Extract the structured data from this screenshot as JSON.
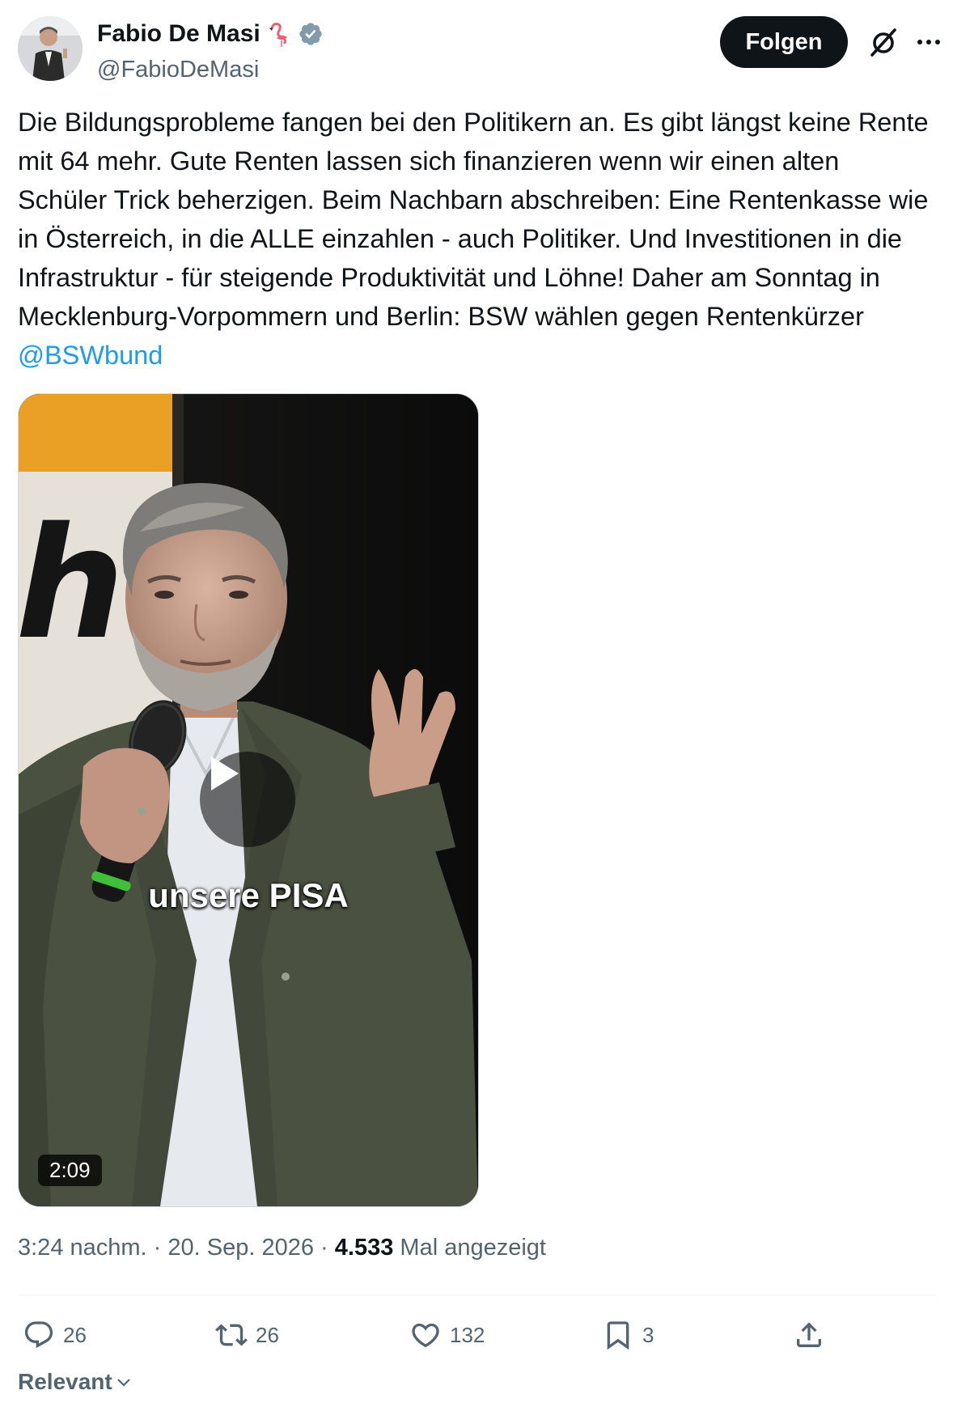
{
  "author": {
    "name": "Fabio De Masi",
    "emoji": "🦩",
    "handle": "@FabioDeMasi",
    "verified": true
  },
  "header": {
    "follow_label": "Folgen"
  },
  "tweet": {
    "text": "Die Bildungsprobleme fangen bei den Politikern an. Es gibt längst keine Rente mit 64 mehr. Gute Renten lassen sich finanzieren wenn wir einen alten Schüler Trick beherzigen. Beim Nachbarn abschreiben: Eine Rentenkasse wie in Österreich, in die ALLE einzahlen - auch Politiker. Und Investitionen in die Infrastruktur - für  steigende Produktivität und Löhne! Daher am Sonntag in Mecklenburg-Vorpommern und Berlin: BSW wählen gegen Rentenkürzer ",
    "mention": "@BSWbund"
  },
  "video": {
    "caption": "unsere PISA",
    "duration": "2:09",
    "banner_letter": "h"
  },
  "meta": {
    "time": "3:24 nachm.",
    "separator": " · ",
    "date": "20. Sep. 2026",
    "views_count": "4.533",
    "views_label": "Mal angezeigt"
  },
  "actions": {
    "replies": "26",
    "reposts": "26",
    "likes": "132",
    "bookmarks": "3"
  },
  "sort": {
    "label": "Relevant"
  },
  "colors": {
    "text": "#0f1419",
    "secondary": "#536471",
    "link": "#1d9bf0",
    "follow_bg": "#0f1419",
    "verified_badge": "#829aab"
  }
}
